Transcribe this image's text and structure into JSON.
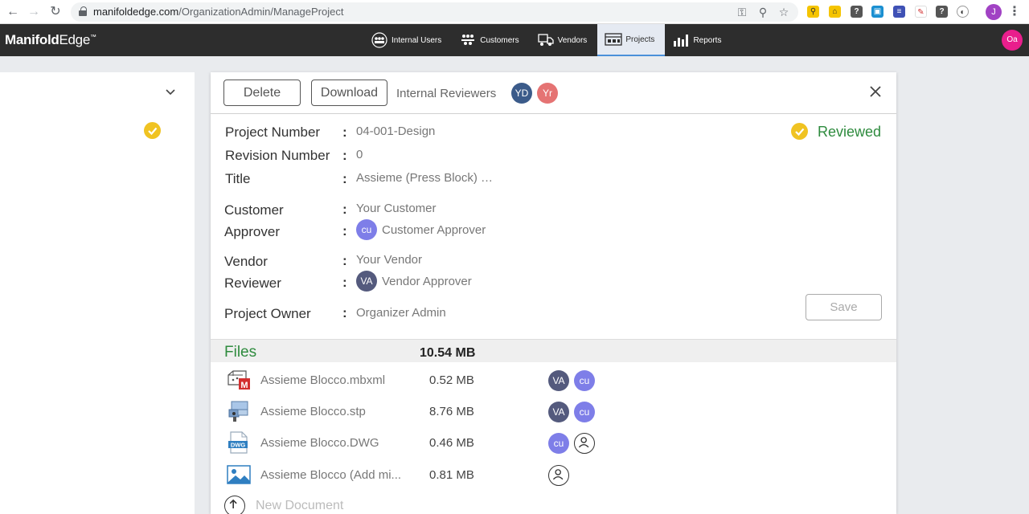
{
  "browser": {
    "url_domain": "manifoldedge.com",
    "url_path": "/OrganizationAdmin/ManageProject",
    "profile_initial": "J"
  },
  "app": {
    "logo_bold": "Manifold",
    "logo_light": "Edge",
    "logo_tm": "™",
    "nav": [
      {
        "label": "Internal Users",
        "icon": "internal-users-icon"
      },
      {
        "label": "Customers",
        "icon": "customers-icon"
      },
      {
        "label": "Vendors",
        "icon": "vendors-icon"
      },
      {
        "label": "Projects",
        "icon": "projects-icon",
        "active": true
      },
      {
        "label": "Reports",
        "icon": "reports-icon"
      }
    ],
    "user_initials": "Oa",
    "accent": "#e91e8c"
  },
  "toolbar": {
    "delete_label": "Delete",
    "download_label": "Download",
    "reviewers_label": "Internal Reviewers",
    "reviewers": [
      "YD",
      "Yr"
    ]
  },
  "project": {
    "status": "Reviewed",
    "fields": {
      "project_number_label": "Project Number",
      "project_number": "04-001-Design",
      "revision_number_label": "Revision Number",
      "revision_number": "0",
      "title_label": "Title",
      "title": "Assieme (Press Block) …",
      "customer_label": "Customer",
      "customer": "Your Customer",
      "approver_label": "Approver",
      "approver_initials": "cu",
      "approver": "Customer Approver",
      "vendor_label": "Vendor",
      "vendor": "Your Vendor",
      "reviewer_label": "Reviewer",
      "reviewer_initials": "VA",
      "reviewer": "Vendor Approver",
      "owner_label": "Project Owner",
      "owner": "Organizer Admin"
    },
    "save_label": "Save",
    "colon": ":"
  },
  "files": {
    "title": "Files",
    "total_size": "10.54 MB",
    "items": [
      {
        "name": "Assieme Blocco.mbxml",
        "size": "0.52 MB",
        "icon": "mbxml-file-icon",
        "avatars": [
          "VA",
          "cu"
        ]
      },
      {
        "name": "Assieme Blocco.stp",
        "size": "8.76 MB",
        "icon": "stp-file-icon",
        "avatars": [
          "VA",
          "cu"
        ]
      },
      {
        "name": "Assieme Blocco.DWG",
        "size": "0.46 MB",
        "icon": "dwg-file-icon",
        "avatars": [
          "cu",
          "user"
        ]
      },
      {
        "name": "Assieme Blocco (Add mi...",
        "size": "0.81 MB",
        "icon": "image-file-icon",
        "avatars": [
          "user"
        ]
      }
    ],
    "new_document_label": "New Document"
  },
  "colors": {
    "header_bg": "#2d2d2d",
    "status_green": "#2e8b3e",
    "check_yellow": "#f0c322"
  }
}
